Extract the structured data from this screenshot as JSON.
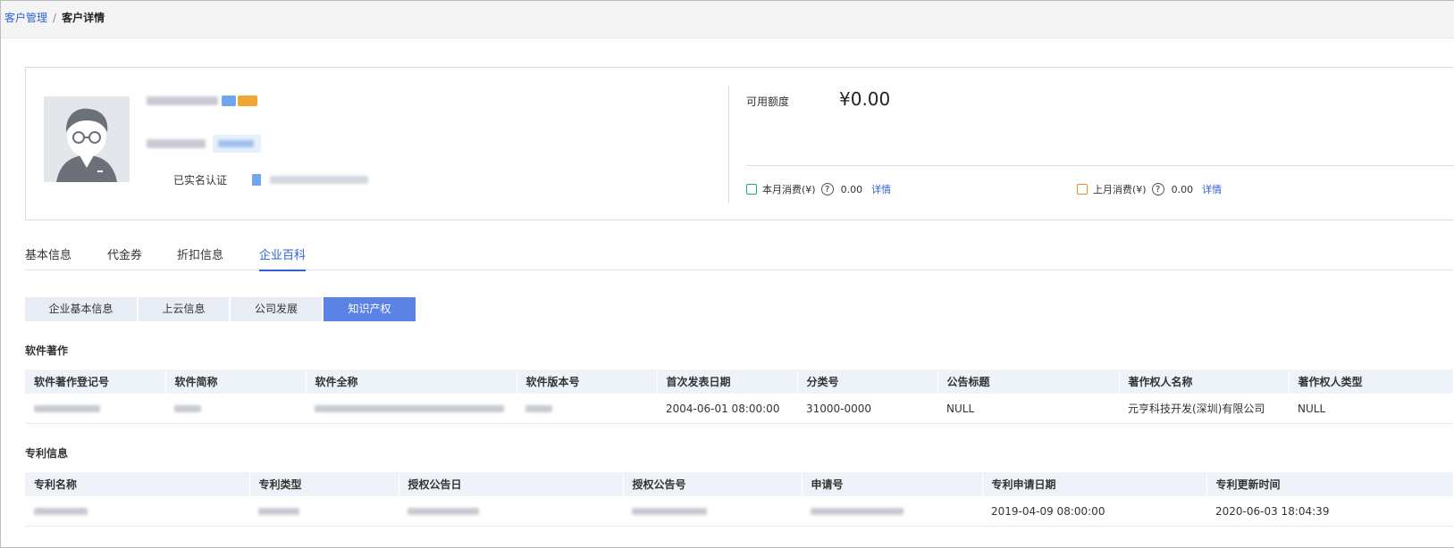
{
  "breadcrumb": {
    "parent": "客户管理",
    "separator": "/",
    "current": "客户详情"
  },
  "profile": {
    "verified_label": "已实名认证",
    "quota_label": "可用额度",
    "quota_value": "¥0.00",
    "this_month_label": "本月消费(¥)",
    "this_month_value": "0.00",
    "last_month_label": "上月消费(¥)",
    "last_month_value": "0.00",
    "detail_link": "详情",
    "colors": {
      "accent": "#2b62d6",
      "vip_tag": "#6fa6ee",
      "gold_tag": "#f3a533",
      "calendar_green": "#1aab8b",
      "calendar_orange": "#f08a24"
    }
  },
  "tabs": [
    "基本信息",
    "代金券",
    "折扣信息",
    "企业百科"
  ],
  "active_tab": "企业百科",
  "segments": [
    "企业基本信息",
    "上云信息",
    "公司发展",
    "知识产权"
  ],
  "active_segment": "知识产权",
  "software": {
    "title": "软件著作",
    "columns": [
      "软件著作登记号",
      "软件简称",
      "软件全称",
      "软件版本号",
      "首次发表日期",
      "分类号",
      "公告标题",
      "著作权人名称",
      "著作权人类型"
    ],
    "row": [
      "",
      "",
      "",
      "",
      "2004-06-01 08:00:00",
      "31000-0000",
      "NULL",
      "元亨科技开发(深圳)有限公司",
      "NULL"
    ]
  },
  "patent": {
    "title": "专利信息",
    "columns": [
      "专利名称",
      "专利类型",
      "授权公告日",
      "授权公告号",
      "申请号",
      "专利申请日期",
      "专利更新时间"
    ],
    "row": [
      "",
      "",
      "",
      "",
      "",
      "2019-04-09 08:00:00",
      "2020-06-03 18:04:39"
    ]
  },
  "icons": [
    "avatar",
    "vip-icon",
    "gold-level-icon",
    "document-icon",
    "calendar-icon",
    "help-icon"
  ]
}
